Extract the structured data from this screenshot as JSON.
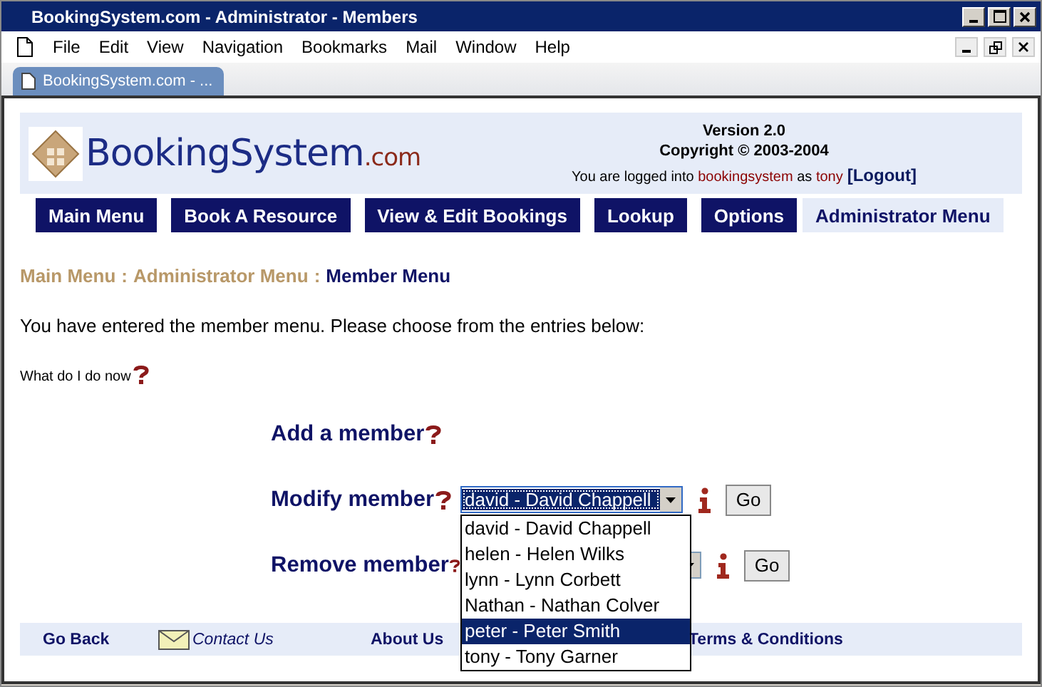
{
  "window": {
    "title": "BookingSystem.com - Administrator - Members"
  },
  "menu": [
    "File",
    "Edit",
    "View",
    "Navigation",
    "Bookmarks",
    "Mail",
    "Window",
    "Help"
  ],
  "tab": {
    "label": "BookingSystem.com - ..."
  },
  "header": {
    "logo_name": "BookingSystem",
    "logo_suffix": ".com",
    "version": "Version 2.0",
    "copyright": "Copyright © 2003-2004",
    "login_prefix": "You are logged into",
    "login_system": "bookingsystem",
    "login_as": "as",
    "login_user": "tony",
    "logout": "[Logout]"
  },
  "nav": [
    {
      "label": "Main Menu",
      "selected": false
    },
    {
      "label": "Book A Resource",
      "selected": false
    },
    {
      "label": "View & Edit Bookings",
      "selected": false
    },
    {
      "label": "Lookup",
      "selected": false
    },
    {
      "label": "Options",
      "selected": false
    },
    {
      "label": "Administrator Menu",
      "selected": true
    }
  ],
  "breadcrumb": {
    "links": [
      "Main Menu",
      "Administrator Menu"
    ],
    "separator": ":",
    "current": "Member Menu"
  },
  "intro": "You have entered the member menu. Please choose from the entries below:",
  "help_link": "What do I do now",
  "actions": [
    {
      "kind": "link",
      "label": "Add a member"
    },
    {
      "kind": "select",
      "label": "Modify member",
      "value": "david - David Chappell",
      "button": "Go",
      "open": true
    },
    {
      "kind": "select",
      "label": "Remove member",
      "button": "Go",
      "open": false
    }
  ],
  "dropdown": [
    {
      "label": "david - David Chappell",
      "selected": false
    },
    {
      "label": "helen - Helen Wilks",
      "selected": false
    },
    {
      "label": "lynn - Lynn Corbett",
      "selected": false
    },
    {
      "label": "Nathan - Nathan Colver",
      "selected": false
    },
    {
      "label": "peter - Peter Smith",
      "selected": true
    },
    {
      "label": "tony - Tony Garner",
      "selected": false
    }
  ],
  "footer": [
    {
      "kind": "link",
      "label": "Go Back"
    },
    {
      "kind": "mail",
      "label": "Contact Us"
    },
    {
      "kind": "link",
      "label": "About Us"
    },
    {
      "kind": "link",
      "label": "Terms & Conditions"
    }
  ]
}
